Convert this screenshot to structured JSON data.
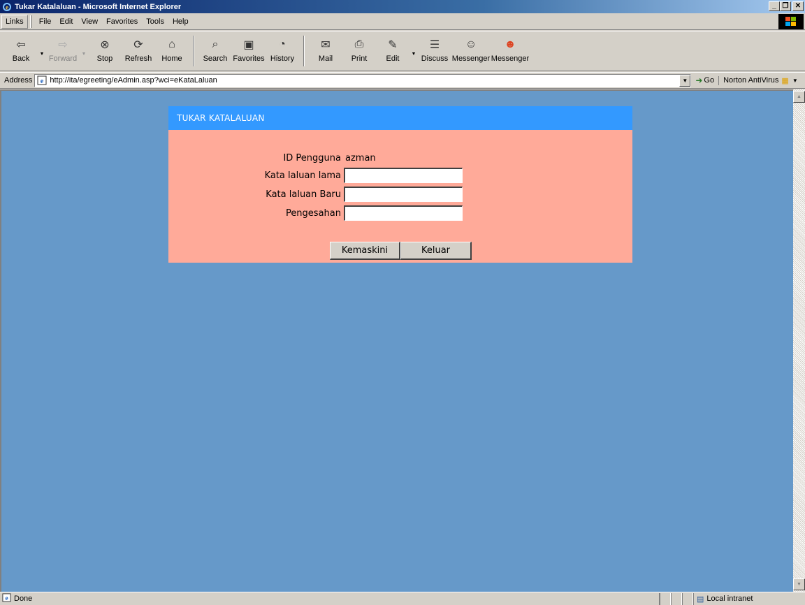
{
  "window": {
    "title": "Tukar Katalaluan - Microsoft Internet Explorer"
  },
  "menubar": {
    "links_label": "Links",
    "items": [
      {
        "label": "File",
        "key": "F",
        "rest": "ile"
      },
      {
        "label": "Edit",
        "key": "E",
        "rest": "dit"
      },
      {
        "label": "View",
        "key": "V",
        "rest": "iew"
      },
      {
        "label": "Favorites",
        "key": "a",
        "pre": "F",
        "rest": "vorites"
      },
      {
        "label": "Tools",
        "key": "T",
        "rest": "ools"
      },
      {
        "label": "Help",
        "key": "H",
        "rest": "elp"
      }
    ]
  },
  "toolbar": {
    "back": "Back",
    "forward": "Forward",
    "stop": "Stop",
    "refresh": "Refresh",
    "home": "Home",
    "search": "Search",
    "favorites": "Favorites",
    "history": "History",
    "mail": "Mail",
    "print": "Print",
    "edit": "Edit",
    "discuss": "Discuss",
    "messenger1": "Messenger",
    "messenger2": "Messenger"
  },
  "address": {
    "label": "Address",
    "url": "http://ita/egreeting/eAdmin.asp?wci=eKataLaluan",
    "go": "Go",
    "norton": "Norton AntiVirus"
  },
  "form": {
    "header": "TUKAR KATALALUAN",
    "user_id_label": "ID Pengguna",
    "user_id_value": "azman",
    "old_password_label": "Kata laluan lama",
    "new_password_label": "Kata laluan Baru",
    "confirm_label": "Pengesahan",
    "old_password_value": "",
    "new_password_value": "",
    "confirm_value": "",
    "update_button": "Kemaskini",
    "exit_button": "Keluar"
  },
  "status": {
    "text": "Done",
    "zone": "Local intranet"
  }
}
